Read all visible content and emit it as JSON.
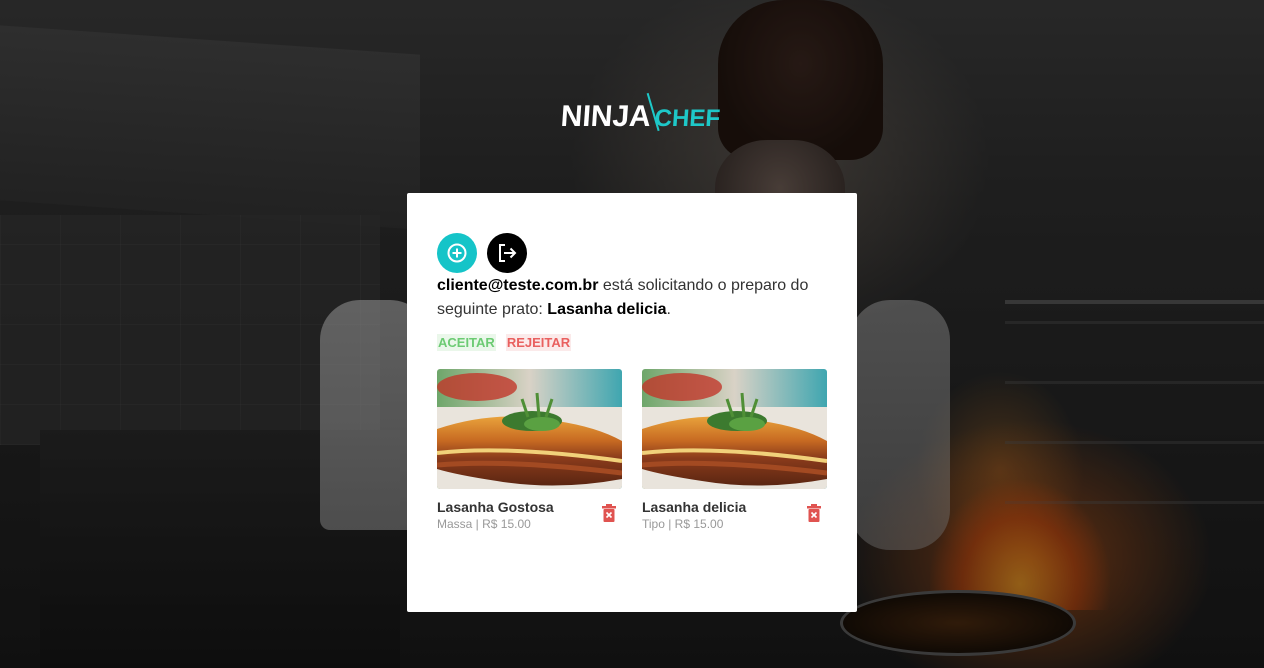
{
  "brand": {
    "logo_part1": "NINJA",
    "logo_part2": "CHEF",
    "accent_color": "#15c4c8"
  },
  "toolbar": {
    "add_icon": "plus-circle-icon",
    "logout_icon": "logout-icon"
  },
  "request": {
    "client_email": "cliente@teste.com.br",
    "text_middle": " está solicitando o preparo do seguinte prato: ",
    "dish_name": "Lasanha delicia",
    "text_end": ".",
    "accept_label": "ACEITAR",
    "reject_label": "REJEITAR",
    "accept_color": "#6ccb73",
    "reject_color": "#e9605f"
  },
  "dishes": [
    {
      "name": "Lasanha Gostosa",
      "meta": "Massa | R$ 15.00",
      "delete_icon": "trash-icon"
    },
    {
      "name": "Lasanha delicia",
      "meta": "Tipo | R$ 15.00",
      "delete_icon": "trash-icon"
    }
  ]
}
